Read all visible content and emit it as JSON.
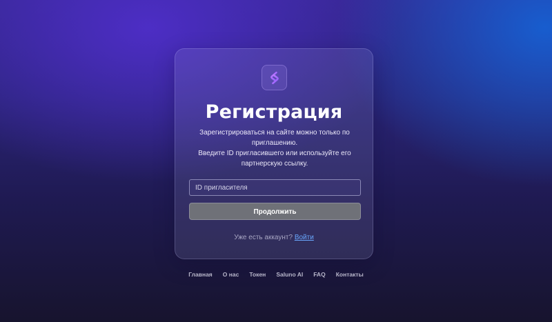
{
  "brand": {
    "logo_icon": "saluno-s-logo-icon",
    "accent_color": "#b06cff"
  },
  "form": {
    "title": "Регистрация",
    "description_line1": "Зарегистрироваться на сайте можно только по приглашению.",
    "description_line2": "Введите ID пригласившего или используйте его партнерскую ссылку.",
    "referrer_input": {
      "placeholder": "ID пригласителя",
      "value": ""
    },
    "continue_label": "Продолжить",
    "have_account_text": "Уже есть аккаунт?",
    "login_link_label": "Войти"
  },
  "footer": {
    "links": [
      "Главная",
      "О нас",
      "Токен",
      "Saluno AI",
      "FAQ",
      "Контакты"
    ]
  }
}
